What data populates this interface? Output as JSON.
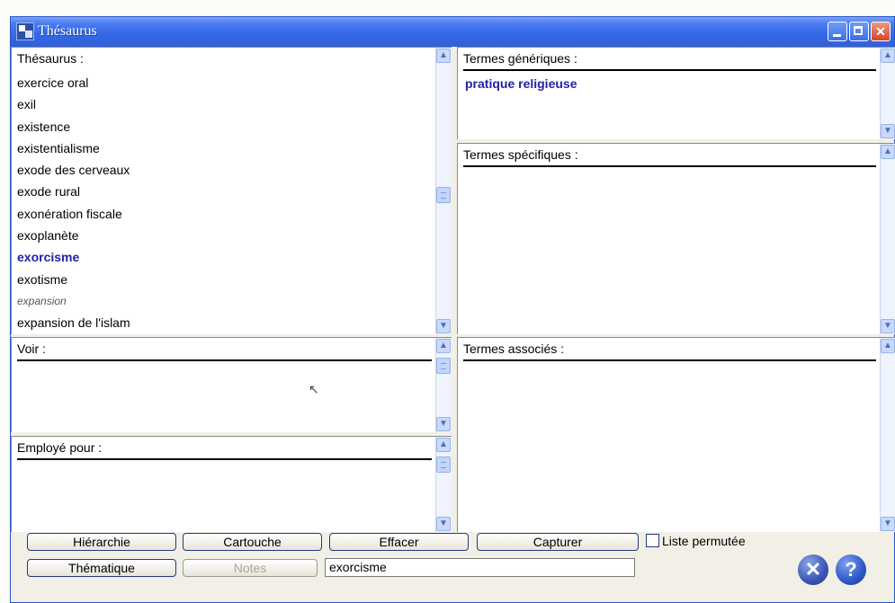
{
  "window": {
    "title": "Thésaurus"
  },
  "thesaurus": {
    "header": "Thésaurus :",
    "items": [
      {
        "label": "exercice oral",
        "style": "normal"
      },
      {
        "label": "exil",
        "style": "normal"
      },
      {
        "label": "existence",
        "style": "normal"
      },
      {
        "label": "existentialisme",
        "style": "normal"
      },
      {
        "label": "exode des cerveaux",
        "style": "normal"
      },
      {
        "label": "exode rural",
        "style": "normal"
      },
      {
        "label": "exonération fiscale",
        "style": "normal"
      },
      {
        "label": "exoplanète",
        "style": "normal"
      },
      {
        "label": "exorcisme",
        "style": "selected"
      },
      {
        "label": "exotisme",
        "style": "normal"
      },
      {
        "label": "expansion",
        "style": "faded"
      },
      {
        "label": "expansion de l'islam",
        "style": "normal"
      }
    ]
  },
  "generic": {
    "header": "Termes génériques :",
    "item": "pratique religieuse"
  },
  "specific": {
    "header": "Termes spécifiques :"
  },
  "voir": {
    "header": "Voir :"
  },
  "associes": {
    "header": "Termes associés :"
  },
  "employe": {
    "header": "Employé pour :"
  },
  "buttons": {
    "hierarchie": "Hiérarchie",
    "cartouche": "Cartouche",
    "effacer": "Effacer",
    "capturer": "Capturer",
    "thematique": "Thématique",
    "notes": "Notes"
  },
  "liste_permutee": {
    "label": "Liste permutée",
    "checked": false
  },
  "search": {
    "value": "exorcisme"
  },
  "icons": {
    "close": "close-circle-icon",
    "help": "help-circle-icon"
  },
  "colors": {
    "titlebar": "#3669e6",
    "selected_text": "#2222a8",
    "window_bg": "#f1efe6"
  }
}
